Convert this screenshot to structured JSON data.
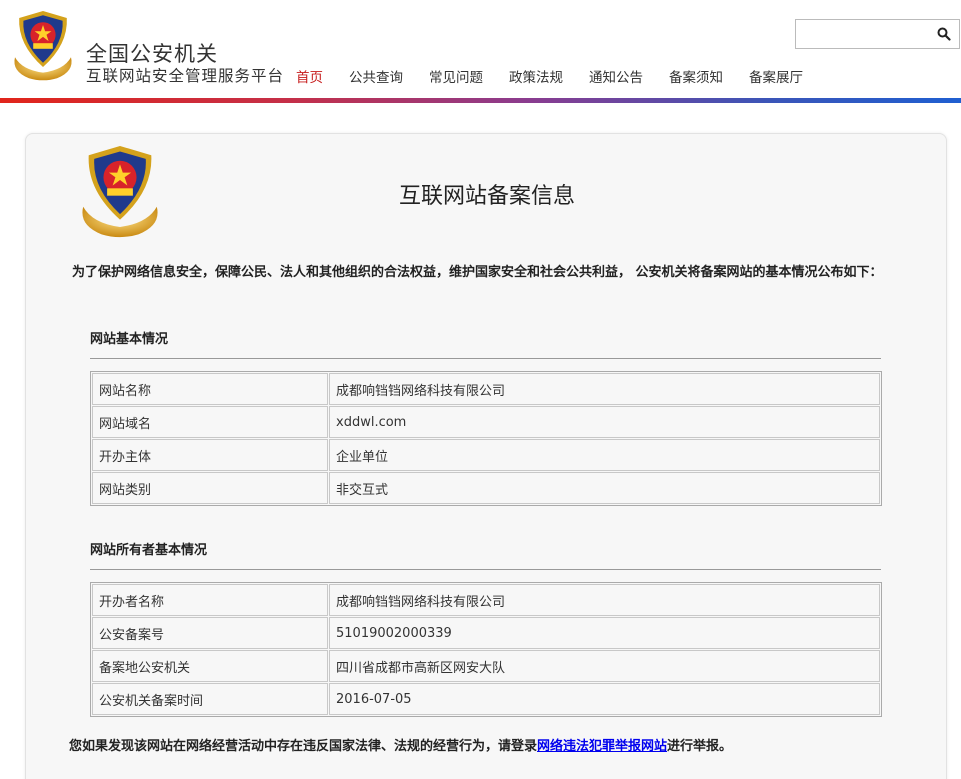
{
  "header": {
    "site_title": "全国公安机关",
    "site_subtitle": "互联网站安全管理服务平台",
    "search": {
      "value": "",
      "placeholder": ""
    },
    "nav": [
      {
        "label": "首页",
        "active": true
      },
      {
        "label": "公共查询",
        "active": false
      },
      {
        "label": "常见问题",
        "active": false
      },
      {
        "label": "政策法规",
        "active": false
      },
      {
        "label": "通知公告",
        "active": false
      },
      {
        "label": "备案须知",
        "active": false
      },
      {
        "label": "备案展厅",
        "active": false
      }
    ]
  },
  "colors": {
    "accent_red": "#c61b1b",
    "bar_start": "#e1251b",
    "bar_end": "#1f5fd1"
  },
  "main": {
    "title": "互联网站备案信息",
    "intro": "为了保护网络信息安全，保障公民、法人和其他组织的合法权益，维护国家安全和社会公共利益， 公安机关将备案网站的基本情况公布如下：",
    "section1": {
      "heading": "网站基本情况",
      "rows": [
        {
          "label": "网站名称",
          "value": "成都响铛铛网络科技有限公司"
        },
        {
          "label": "网站域名",
          "value": "xddwl.com"
        },
        {
          "label": "开办主体",
          "value": "企业单位"
        },
        {
          "label": "网站类别",
          "value": "非交互式"
        }
      ]
    },
    "section2": {
      "heading": "网站所有者基本情况",
      "rows": [
        {
          "label": "开办者名称",
          "value": "成都响铛铛网络科技有限公司"
        },
        {
          "label": "公安备案号",
          "value": "51019002000339"
        },
        {
          "label": "备案地公安机关",
          "value": "四川省成都市高新区网安大队"
        },
        {
          "label": "公安机关备案时间",
          "value": "2016-07-05"
        }
      ]
    },
    "footer": {
      "prefix": "您如果发现该网站在网络经营活动中存在违反国家法律、法规的经营行为，请登录",
      "link": "网络违法犯罪举报网站",
      "suffix": "进行举报。"
    }
  },
  "icons": {
    "emblem": "police-emblem-icon",
    "search": "search-icon"
  }
}
